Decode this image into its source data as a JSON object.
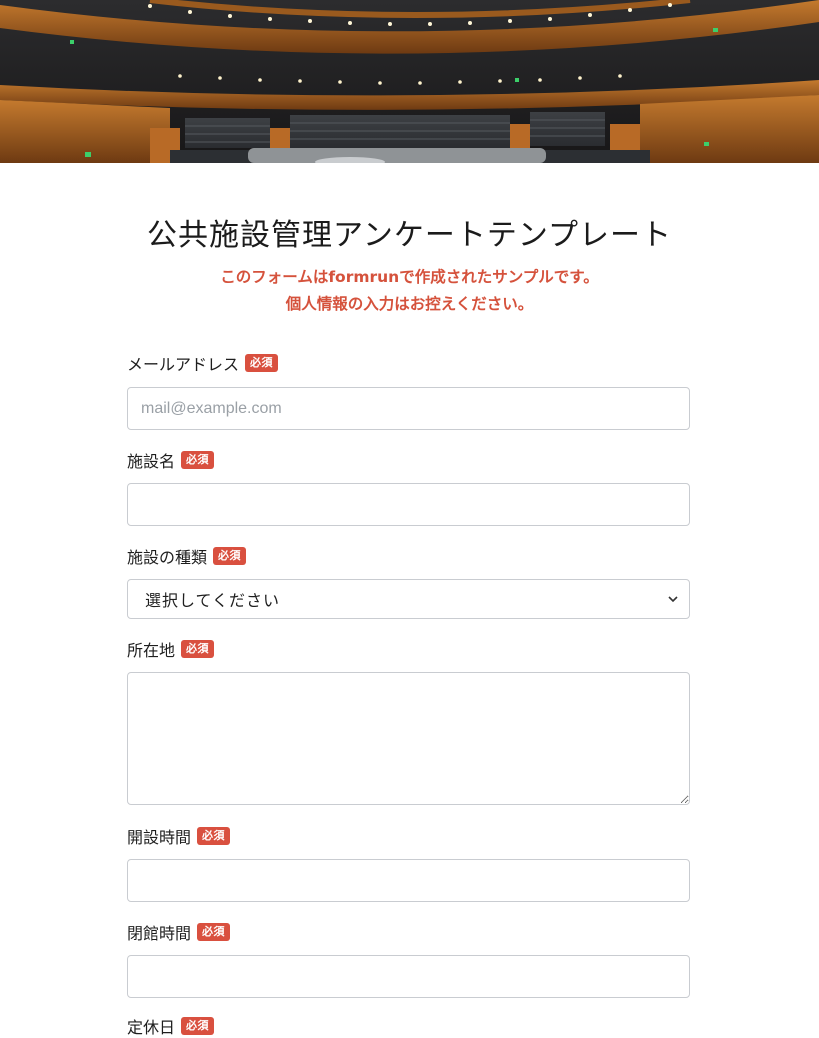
{
  "header": {
    "image_alt": "concert-hall-auditorium",
    "title": "公共施設管理アンケートテンプレート",
    "notice_line1": "このフォームはformrunで作成されたサンプルです。",
    "notice_line2": "個人情報の入力はお控えください。"
  },
  "form": {
    "required_badge": "必須",
    "fields": [
      {
        "label": "メールアドレス",
        "required": true,
        "type": "email",
        "placeholder": "mail@example.com",
        "value": ""
      },
      {
        "label": "施設名",
        "required": true,
        "type": "text",
        "placeholder": "",
        "value": ""
      },
      {
        "label": "施設の種類",
        "required": true,
        "type": "select",
        "selected": "選択してください"
      },
      {
        "label": "所在地",
        "required": true,
        "type": "textarea",
        "value": ""
      },
      {
        "label": "開設時間",
        "required": true,
        "type": "text",
        "value": ""
      },
      {
        "label": "閉館時間",
        "required": true,
        "type": "text",
        "value": ""
      },
      {
        "label": "定休日",
        "required": true,
        "type": "text",
        "value": ""
      }
    ]
  },
  "colors": {
    "accent_red": "#d9503f",
    "notice_red": "#d5523c",
    "input_border": "#c9ccd1"
  }
}
